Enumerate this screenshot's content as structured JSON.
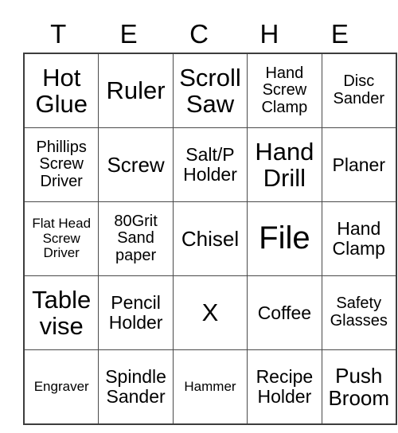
{
  "card": {
    "title_letters": [
      "T",
      "E",
      "C",
      "H",
      "E"
    ],
    "columns": 5,
    "rows": 5,
    "border_color": "#4a4a4a",
    "text_color": "#000000",
    "background_color": "#ffffff",
    "free_space_label": "X",
    "cells": [
      [
        {
          "text": "Hot\nGlue",
          "size": "fs-xl"
        },
        {
          "text": "Ruler",
          "size": "fs-xl"
        },
        {
          "text": "Scroll\nSaw",
          "size": "fs-xl"
        },
        {
          "text": "Hand\nScrew\nClamp",
          "size": "fs-sm"
        },
        {
          "text": "Disc\nSander",
          "size": "fs-sm"
        }
      ],
      [
        {
          "text": "Phillips\nScrew\nDriver",
          "size": "fs-sm"
        },
        {
          "text": "Screw",
          "size": "fs-lg"
        },
        {
          "text": "Salt/P\nHolder",
          "size": "fs-md"
        },
        {
          "text": "Hand\nDrill",
          "size": "fs-xl"
        },
        {
          "text": "Planer",
          "size": "fs-md"
        }
      ],
      [
        {
          "text": "Flat Head\nScrew\nDriver",
          "size": "fs-xs"
        },
        {
          "text": "80Grit\nSand\npaper",
          "size": "fs-sm"
        },
        {
          "text": "Chisel",
          "size": "fs-lg"
        },
        {
          "text": "File",
          "size": "fs-xxl"
        },
        {
          "text": "Hand\nClamp",
          "size": "fs-md"
        }
      ],
      [
        {
          "text": "Table\nvise",
          "size": "fs-xl"
        },
        {
          "text": "Pencil\nHolder",
          "size": "fs-md"
        },
        {
          "text": "X",
          "size": "fs-xl"
        },
        {
          "text": "Coffee",
          "size": "fs-md"
        },
        {
          "text": "Safety\nGlasses",
          "size": "fs-sm"
        }
      ],
      [
        {
          "text": "Engraver",
          "size": "fs-xs"
        },
        {
          "text": "Spindle\nSander",
          "size": "fs-md"
        },
        {
          "text": "Hammer",
          "size": "fs-xs"
        },
        {
          "text": "Recipe\nHolder",
          "size": "fs-md"
        },
        {
          "text": "Push\nBroom",
          "size": "fs-lg"
        }
      ]
    ]
  }
}
